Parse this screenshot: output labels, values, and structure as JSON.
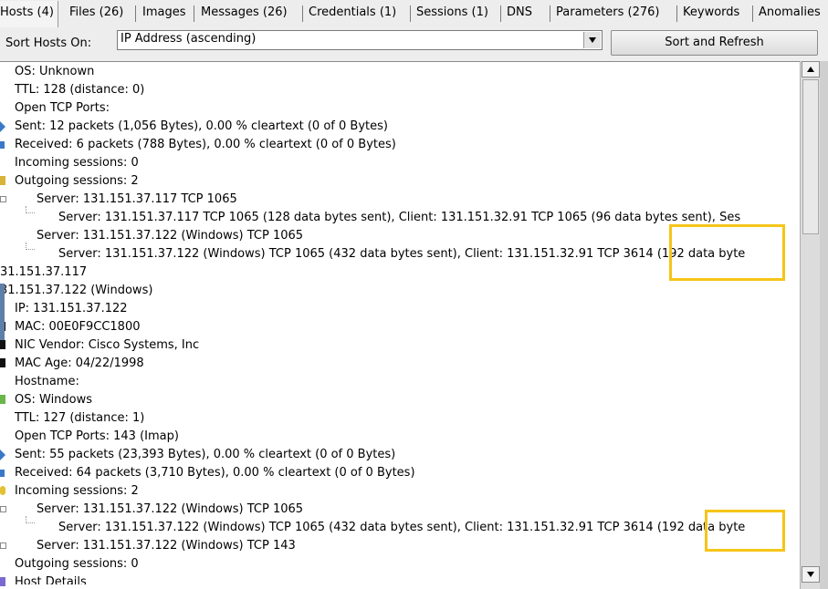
{
  "tabs": [
    {
      "label": "Hosts (4)"
    },
    {
      "label": "Files (26)"
    },
    {
      "label": "Images"
    },
    {
      "label": "Messages (26)"
    },
    {
      "label": "Credentials (1)"
    },
    {
      "label": "Sessions (1)"
    },
    {
      "label": "DNS"
    },
    {
      "label": "Parameters (276)"
    },
    {
      "label": "Keywords"
    },
    {
      "label": "Anomalies"
    }
  ],
  "sort": {
    "label": "Sort Hosts On:",
    "selected": "IP Address (ascending)",
    "button": "Sort and Refresh"
  },
  "tree": {
    "rows": [
      "OS: Unknown",
      "TTL: 128 (distance: 0)",
      "Open TCP Ports:",
      "Sent: 12 packets (1,056 Bytes), 0.00 % cleartext (0 of 0 Bytes)",
      "Received: 6 packets (788 Bytes), 0.00 % cleartext (0 of 0 Bytes)",
      "Incoming sessions: 0",
      "Outgoing sessions: 2",
      "Server: 131.151.37.117 TCP 1065",
      "Server: 131.151.37.117 TCP 1065 (128 data bytes sent), Client: 131.151.32.91 TCP 1065 (96 data bytes sent), Ses",
      "Server: 131.151.37.122 (Windows) TCP 1065",
      "Server: 131.151.37.122 (Windows) TCP 1065 (432 data bytes sent), Client: 131.151.32.91 TCP 3614 (192 data byte",
      "31.151.37.117",
      "31.151.37.122 (Windows)",
      "IP: 131.151.37.122",
      "MAC: 00E0F9CC1800",
      "NIC Vendor: Cisco Systems, Inc",
      "MAC Age: 04/22/1998",
      "Hostname:",
      "OS: Windows",
      "TTL: 127 (distance: 1)",
      "Open TCP Ports: 143 (Imap)",
      "Sent: 55 packets (23,393 Bytes), 0.00 % cleartext (0 of 0 Bytes)",
      "Received: 64 packets (3,710 Bytes), 0.00 % cleartext (0 of 0 Bytes)",
      "Incoming sessions: 2",
      "Server: 131.151.37.122 (Windows) TCP 1065",
      "Server: 131.151.37.122 (Windows) TCP 1065 (432 data bytes sent), Client: 131.151.32.91 TCP 3614 (192 data byte",
      "Server: 131.151.37.122 (Windows) TCP 143",
      "Outgoing sessions: 0",
      "Host Details"
    ]
  },
  "colors": {
    "highlight": "#f5c518",
    "node_icon": "#3a78c8"
  },
  "icons": [
    "sent-arrow-icon",
    "received-icon",
    "outgoing-icon",
    "mac-icon",
    "nic-icon",
    "os-icon",
    "incoming-icon",
    "host-details-icon"
  ]
}
